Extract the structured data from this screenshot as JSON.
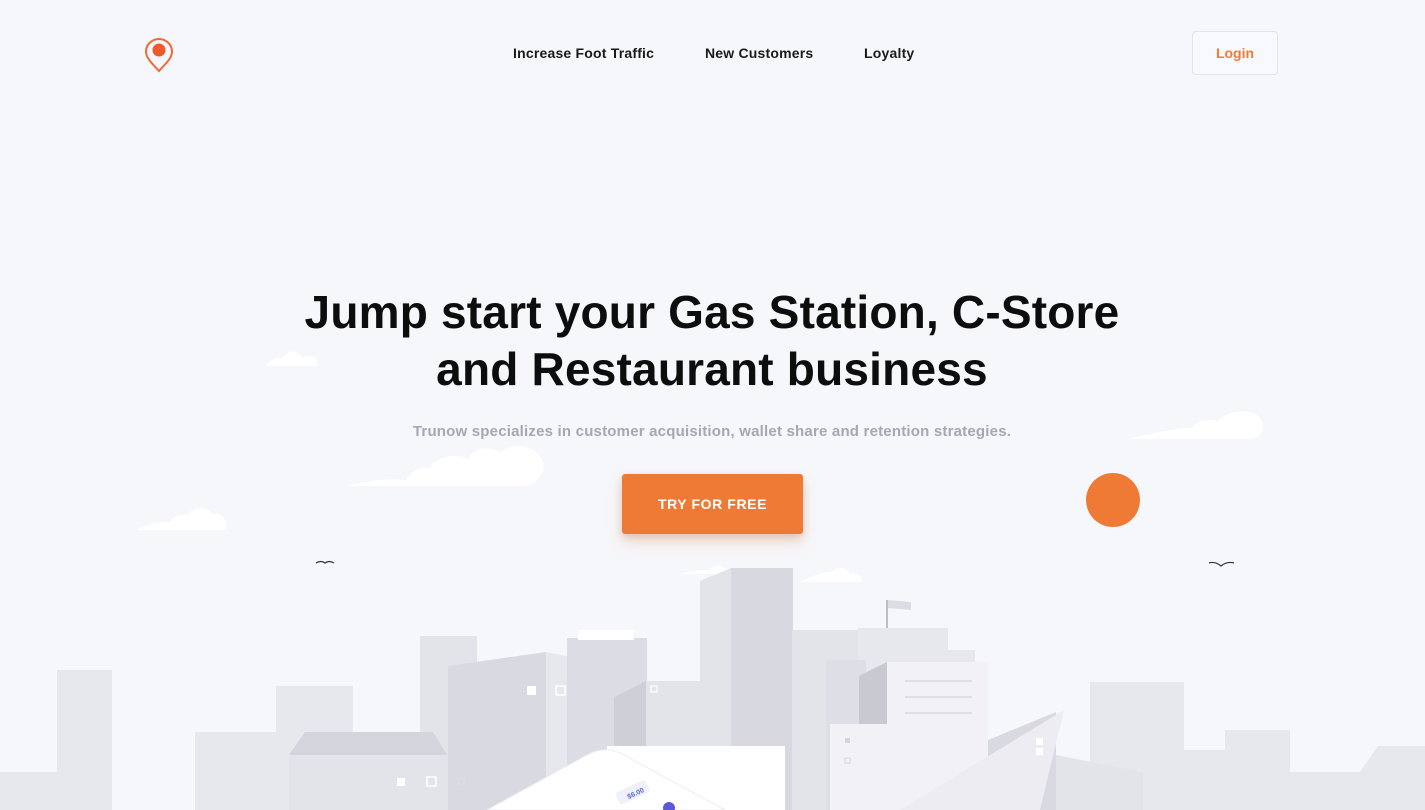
{
  "brand": {
    "accent": "#ef7a35",
    "logo_icon": "map-pin-icon"
  },
  "nav": {
    "items": [
      {
        "label": "Increase Foot Traffic"
      },
      {
        "label": "New Customers"
      },
      {
        "label": "Loyalty"
      }
    ],
    "login_label": "Login"
  },
  "hero": {
    "title_line1": "Jump start your Gas Station, C-Store",
    "title_line2": "and Restaurant business",
    "subtitle": "Trunow specializes in customer acquisition, wallet share and retention strategies.",
    "cta_label": "TRY FOR FREE"
  },
  "illustration": {
    "phone_amount": "$6.00"
  }
}
